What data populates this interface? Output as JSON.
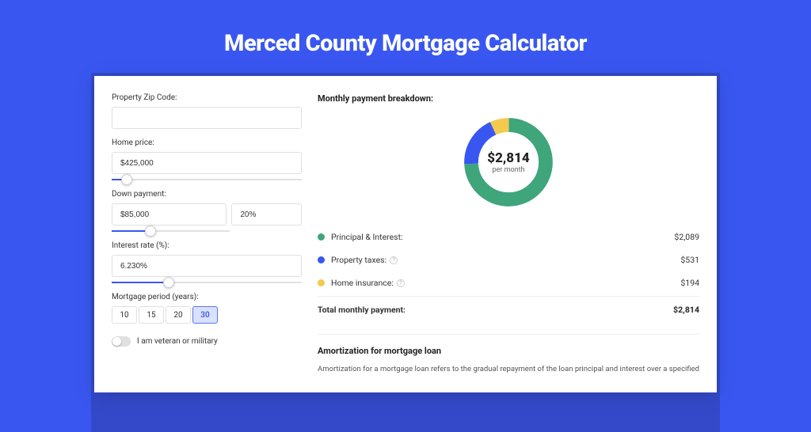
{
  "title": "Merced County Mortgage Calculator",
  "form": {
    "zip_label": "Property Zip Code:",
    "zip_value": "",
    "home_price_label": "Home price:",
    "home_price_value": "$425,000",
    "down_payment_label": "Down payment:",
    "down_payment_amount": "$85,000",
    "down_payment_pct": "20%",
    "interest_label": "Interest rate (%):",
    "interest_value": "6.230%",
    "period_label": "Mortgage period (years):",
    "periods": [
      "10",
      "15",
      "20",
      "30"
    ],
    "selected_period": "30",
    "veteran_label": "I am veteran or military"
  },
  "breakdown": {
    "header": "Monthly payment breakdown:",
    "center_value": "$2,814",
    "center_label": "per month",
    "rows": [
      {
        "label": "Principal & Interest:",
        "value": "$2,089",
        "color": "green",
        "info": false
      },
      {
        "label": "Property taxes:",
        "value": "$531",
        "color": "blue",
        "info": true
      },
      {
        "label": "Home insurance:",
        "value": "$194",
        "color": "yellow",
        "info": true
      }
    ],
    "total_label": "Total monthly payment:",
    "total_value": "$2,814"
  },
  "amortization": {
    "title": "Amortization for mortgage loan",
    "text": "Amortization for a mortgage loan refers to the gradual repayment of the loan principal and interest over a specified"
  },
  "chart_data": {
    "type": "pie",
    "title": "Monthly payment breakdown",
    "series": [
      {
        "name": "Principal & Interest",
        "value": 2089,
        "color": "#3fa57b"
      },
      {
        "name": "Property taxes",
        "value": 531,
        "color": "#3957f0"
      },
      {
        "name": "Home insurance",
        "value": 194,
        "color": "#f3ca4d"
      }
    ],
    "total": 2814,
    "unit": "$ per month"
  },
  "colors": {
    "accent": "#3957f0",
    "green": "#3fa57b",
    "yellow": "#f3ca4d"
  }
}
